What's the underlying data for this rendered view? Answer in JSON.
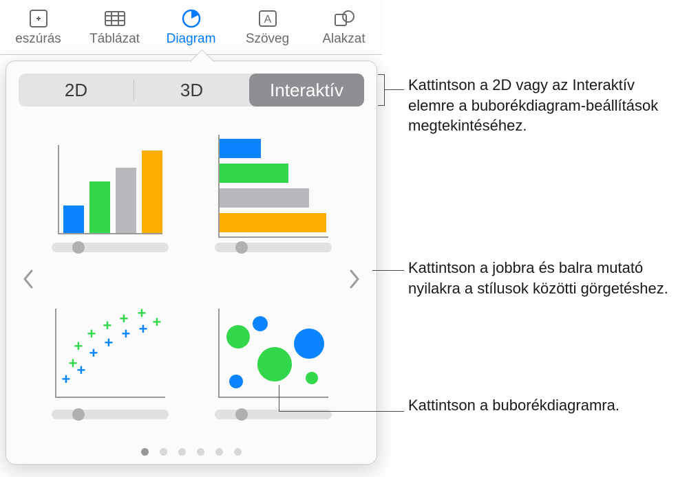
{
  "toolbar": {
    "items": [
      {
        "label": "eszúrás"
      },
      {
        "label": "Táblázat"
      },
      {
        "label": "Diagram"
      },
      {
        "label": "Szöveg"
      },
      {
        "label": "Alakzat"
      }
    ]
  },
  "popover": {
    "tabs": [
      {
        "label": "2D"
      },
      {
        "label": "3D"
      },
      {
        "label": "Interaktív"
      }
    ],
    "charts": [
      {
        "name": "column-chart-thumb"
      },
      {
        "name": "bar-chart-thumb"
      },
      {
        "name": "scatter-chart-thumb"
      },
      {
        "name": "bubble-chart-thumb"
      }
    ],
    "page_count": 6,
    "current_page": 1
  },
  "callouts": {
    "tabs": "Kattintson a 2D vagy az Interaktív elemre a buborékdiagram-beállítások megtekintéséhez.",
    "arrows": "Kattintson a jobbra és balra mutató nyilakra a stílusok közötti görgetéshez.",
    "bubble": "Kattintson a buborékdiagramra."
  },
  "colors": {
    "blue": "#0a84ff",
    "green": "#32d74b",
    "gray": "#b9b9bd",
    "orange": "#fcae00",
    "track": "#e1e1e4"
  }
}
